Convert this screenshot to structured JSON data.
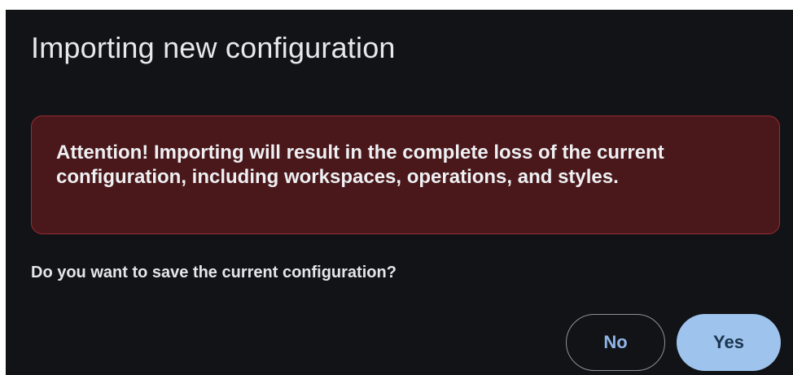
{
  "dialog": {
    "title": "Importing new configuration",
    "alert": {
      "text": "Attention! Importing will result in the complete loss of the current configuration, including workspaces, operations, and styles."
    },
    "question": "Do you want to save the current configuration?",
    "buttons": {
      "no_label": "No",
      "yes_label": "Yes"
    }
  },
  "colors": {
    "background": "#111317",
    "alert_background": "#4a181b",
    "alert_border": "#9b2d33",
    "primary_button": "#9ec3ec",
    "primary_button_text": "#1c3550",
    "outline_button_text": "#8fb6e8"
  }
}
